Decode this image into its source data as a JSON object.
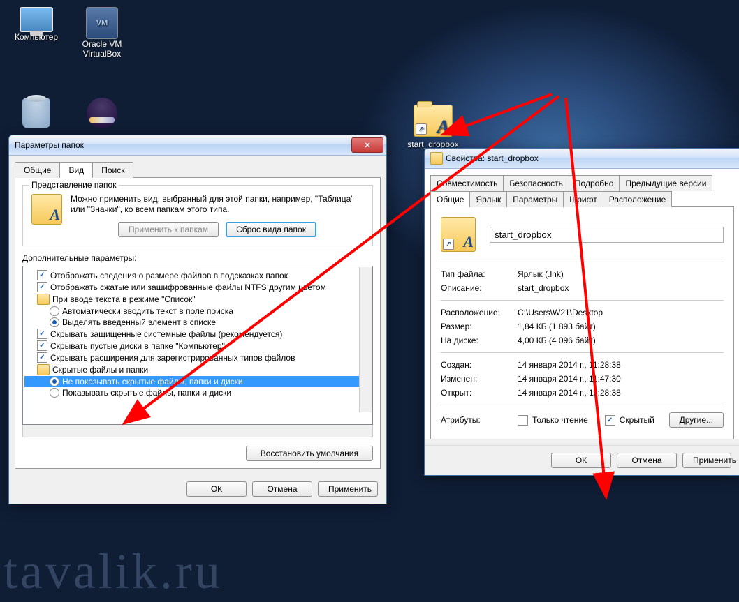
{
  "watermark": "tavalik.ru",
  "desktop": {
    "computer": "Компьютер",
    "vbox": "Oracle VM VirtualBox",
    "start_dropbox": "start_dropbox"
  },
  "folderOptions": {
    "title": "Параметры папок",
    "tabs": {
      "general": "Общие",
      "view": "Вид",
      "search": "Поиск"
    },
    "folderViews": {
      "legend": "Представление папок",
      "desc": "Можно применить вид, выбранный для этой папки, например, \"Таблица\" или \"Значки\", ко всем папкам этого типа.",
      "apply": "Применить к папкам",
      "reset": "Сброс вида папок"
    },
    "advancedLabel": "Дополнительные параметры:",
    "items": {
      "i0": "Отображать сведения о размере файлов в подсказках папок",
      "i1": "Отображать сжатые или зашифрованные файлы NTFS другим цветом",
      "i2": "При вводе текста в режиме \"Список\"",
      "i3": "Автоматически вводить текст в поле поиска",
      "i4": "Выделять введенный элемент в списке",
      "i5": "Скрывать защищенные системные файлы (рекомендуется)",
      "i6": "Скрывать пустые диски в папке \"Компьютер\"",
      "i7": "Скрывать расширения для зарегистрированных типов файлов",
      "i8": "Скрытые файлы и папки",
      "i9": "Не показывать скрытые файлы, папки и диски",
      "i10": "Показывать скрытые файлы, папки и диски"
    },
    "restoreDefaults": "Восстановить умолчания",
    "ok": "ОК",
    "cancel": "Отмена",
    "applyBtn": "Применить"
  },
  "properties": {
    "title": "Свойства: start_dropbox",
    "tabs": {
      "compatibility": "Совместимость",
      "security": "Безопасность",
      "details": "Подробно",
      "previous": "Предыдущие версии",
      "general": "Общие",
      "shortcut": "Ярлык",
      "params": "Параметры",
      "font": "Шрифт",
      "layout": "Расположение"
    },
    "filename": "start_dropbox",
    "labels": {
      "filetype": "Тип файла:",
      "description": "Описание:",
      "location": "Расположение:",
      "size": "Размер:",
      "ondisk": "На диске:",
      "created": "Создан:",
      "modified": "Изменен:",
      "accessed": "Открыт:",
      "attributes": "Атрибуты:"
    },
    "values": {
      "filetype": "Ярлык (.lnk)",
      "description": "start_dropbox",
      "location": "C:\\Users\\W21\\Desktop",
      "size": "1,84 КБ (1 893 байт)",
      "ondisk": "4,00 КБ (4 096 байт)",
      "created": "14 января 2014 г., 11:28:38",
      "modified": "14 января 2014 г., 11:47:30",
      "accessed": "14 января 2014 г., 11:28:38"
    },
    "readonly": "Только чтение",
    "hidden": "Скрытый",
    "otherBtn": "Другие...",
    "ok": "ОК",
    "cancel": "Отмена",
    "apply": "Применить"
  }
}
